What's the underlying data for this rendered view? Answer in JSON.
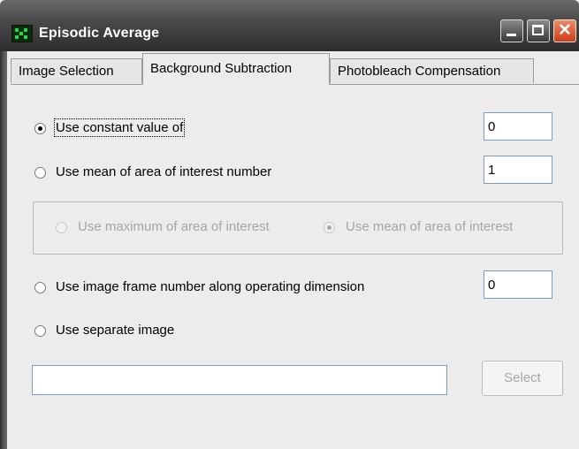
{
  "window": {
    "title": "Episodic Average",
    "minimize_icon": "minimize-icon",
    "maximize_icon": "maximize-icon",
    "close_icon": "close-icon",
    "close_glyph": "✕"
  },
  "tabs": [
    {
      "label": "Image Selection",
      "active": false
    },
    {
      "label": "Background Subtraction",
      "active": true
    },
    {
      "label": "Photobleach Compensation",
      "active": false
    }
  ],
  "options": {
    "constant": {
      "label": "Use constant value of",
      "selected": true,
      "value": "0"
    },
    "aoi_mean": {
      "label": "Use mean of area of interest number",
      "selected": false,
      "value": "1"
    },
    "aoi_sub": {
      "max": {
        "label": "Use maximum of area of interest",
        "selected": false,
        "enabled": false
      },
      "mean": {
        "label": "Use mean of area of interest",
        "selected": true,
        "enabled": false
      }
    },
    "frame": {
      "label": "Use image frame number along operating dimension",
      "selected": false,
      "value": "0"
    },
    "separate": {
      "label": "Use separate image",
      "selected": false,
      "path": ""
    }
  },
  "select_button": {
    "label": "Select",
    "enabled": false
  }
}
